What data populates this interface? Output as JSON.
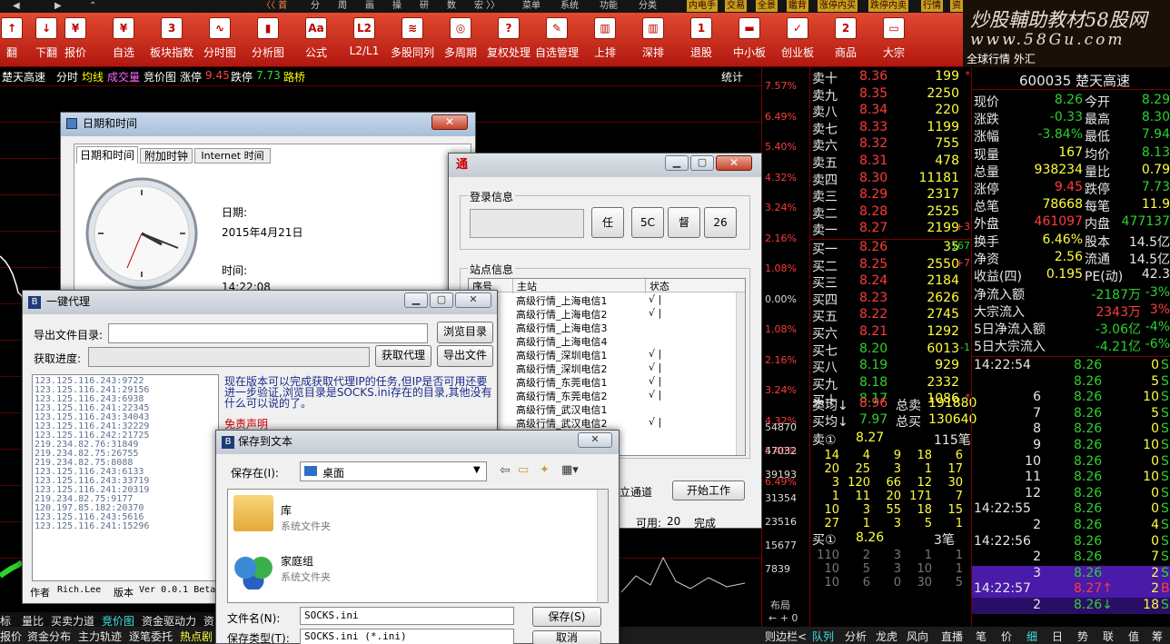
{
  "topstrip": {
    "items": [
      "〈〈 首",
      "分",
      "周",
      "画",
      "操",
      "研",
      "数",
      "宏 〉〉",
      "菜单",
      "系统",
      "功能",
      "分类"
    ],
    "tags": [
      "内电手",
      "交易",
      "全景",
      "鑑背",
      "涨停内买",
      "跌停内卖",
      "行情",
      "资"
    ]
  },
  "toolbar": {
    "buttons": [
      {
        "label": "翻",
        "icon": "arrow-up-icon"
      },
      {
        "label": "下翻",
        "icon": "arrow-down-icon"
      },
      {
        "label": "报价",
        "icon": "yen-icon"
      },
      {
        "label": "自选",
        "icon": "star-yen-icon"
      },
      {
        "label": "板块指数",
        "icon": "calendar-3-icon"
      },
      {
        "label": "分时图",
        "icon": "line-chart-icon"
      },
      {
        "label": "分析图",
        "icon": "candle-icon"
      },
      {
        "label": "公式",
        "icon": "formula-icon"
      },
      {
        "label": "L2/L1",
        "icon": "l2-icon"
      },
      {
        "label": "多股同列",
        "icon": "multi-chart-icon"
      },
      {
        "label": "多周期",
        "icon": "period-icon"
      },
      {
        "label": "复权处理",
        "icon": "adjust-icon"
      },
      {
        "label": "自选管理",
        "icon": "manage-icon"
      },
      {
        "label": "上排",
        "icon": "bars-icon"
      },
      {
        "label": "深排",
        "icon": "bars2-icon"
      },
      {
        "label": "退股",
        "icon": "calendar-1-icon"
      },
      {
        "label": "中小板",
        "icon": "panel-icon"
      },
      {
        "label": "创业板",
        "icon": "board-icon"
      },
      {
        "label": "商品",
        "icon": "calendar-2-icon"
      },
      {
        "label": "大宗",
        "icon": "folder-icon"
      }
    ],
    "ic_text": [
      "↑",
      "↓",
      "¥",
      "¥",
      "3",
      "∿",
      "▮",
      "Aa",
      "L2",
      "≋",
      "◎",
      "?",
      "✎",
      "▥",
      "▥",
      "1",
      "▬",
      "✓",
      "2",
      "▭"
    ]
  },
  "logo": {
    "line1": "炒股輔助教材58股网",
    "line2": "www.58Gu.com",
    "line3": "全球行情    外汇"
  },
  "chart": {
    "header": {
      "stock": "楚天高速",
      "t1": "分时",
      "t2": "均线",
      "t3": "成交量",
      "t4": "竞价图",
      "t5": "涨停",
      "zt": "9.45",
      "t6": "跌停",
      "dt": "7.73",
      "t7": "路桥",
      "tj": "统计"
    },
    "pcts": [
      "7.57%",
      "6.49%",
      "5.40%",
      "4.32%",
      "3.24%",
      "2.16%",
      "1.08%",
      "0.00%",
      "1.08%",
      "2.16%",
      "3.24%",
      "4.32%",
      "5.40%",
      "6.49%"
    ],
    "vols": [
      "54870",
      "47032",
      "39193",
      "31354",
      "23516",
      "15677",
      "7839"
    ],
    "bottom_labels": {
      "b": "布局",
      "nav": "← + 0"
    }
  },
  "book": {
    "sell": [
      {
        "l": "卖十",
        "p": "8.36",
        "v": "199",
        "f": "*"
      },
      {
        "l": "卖九",
        "p": "8.35",
        "v": "2250",
        "f": ""
      },
      {
        "l": "卖八",
        "p": "8.34",
        "v": "220",
        "f": ""
      },
      {
        "l": "卖七",
        "p": "8.33",
        "v": "1199",
        "f": ""
      },
      {
        "l": "卖六",
        "p": "8.32",
        "v": "755",
        "f": ""
      },
      {
        "l": "卖五",
        "p": "8.31",
        "v": "478",
        "f": ""
      },
      {
        "l": "卖四",
        "p": "8.30",
        "v": "11181",
        "f": ""
      },
      {
        "l": "卖三",
        "p": "8.29",
        "v": "2317",
        "f": ""
      },
      {
        "l": "卖二",
        "p": "8.28",
        "v": "2525",
        "f": ""
      },
      {
        "l": "卖一",
        "p": "8.27",
        "v": "2199",
        "f": "+3"
      }
    ],
    "buy": [
      {
        "l": "买一",
        "p": "8.26",
        "v": "35",
        "f": "-167"
      },
      {
        "l": "买二",
        "p": "8.25",
        "v": "2550",
        "f": "+7"
      },
      {
        "l": "买三",
        "p": "8.24",
        "v": "2184",
        "f": ""
      },
      {
        "l": "买四",
        "p": "8.23",
        "v": "2626",
        "f": ""
      },
      {
        "l": "买五",
        "p": "8.22",
        "v": "2745",
        "f": ""
      },
      {
        "l": "买六",
        "p": "8.21",
        "v": "1292",
        "f": ""
      },
      {
        "l": "买七",
        "p": "8.20",
        "v": "6013",
        "f": "-1"
      },
      {
        "l": "买八",
        "p": "8.19",
        "v": "929",
        "f": ""
      },
      {
        "l": "买九",
        "p": "8.18",
        "v": "2332",
        "f": ""
      },
      {
        "l": "买十",
        "p": "8.17",
        "v": "1086",
        "f": "*"
      }
    ],
    "avg_sell": {
      "l": "卖均↓",
      "p": "8.96",
      "l2": "总卖",
      "v": "191880"
    },
    "avg_buy": {
      "l": "买均↓",
      "p": "7.97",
      "l2": "总买",
      "v": "130640"
    },
    "sell1": {
      "l": "卖①",
      "p": "8.27",
      "v": "115笔"
    },
    "sell_grid": [
      [
        "14",
        "4",
        "9",
        "18",
        "6"
      ],
      [
        "20",
        "25",
        "3",
        "1",
        "17"
      ],
      [
        "3",
        "120",
        "66",
        "12",
        "30"
      ],
      [
        "1",
        "11",
        "20",
        "171",
        "7"
      ],
      [
        "10",
        "3",
        "55",
        "18",
        "15"
      ],
      [
        "27",
        "1",
        "3",
        "5",
        "1"
      ]
    ],
    "buy1": {
      "l": "买①",
      "p": "8.26",
      "v": "3笔"
    },
    "buy_grid": [
      [
        "110",
        "2",
        "3",
        "1",
        "1"
      ],
      [
        "10",
        "5",
        "3",
        "10",
        "1"
      ],
      [
        "10",
        "6",
        "0",
        "30",
        "5"
      ]
    ]
  },
  "info": {
    "title": "600035 楚天高速",
    "rows": [
      {
        "a": "现价",
        "b": "8.26",
        "c": "今开",
        "d": "8.29"
      },
      {
        "a": "涨跌",
        "b": "-0.33",
        "c": "最高",
        "d": "8.30"
      },
      {
        "a": "涨幅",
        "b": "-3.84%",
        "c": "最低",
        "d": "7.94"
      },
      {
        "a": "现量",
        "b": "167",
        "c": "均价",
        "d": "8.13"
      },
      {
        "a": "总量",
        "b": "938234",
        "c": "量比",
        "d": "0.79"
      },
      {
        "a": "涨停",
        "b": "9.45",
        "c": "跌停",
        "d": "7.73"
      },
      {
        "a": "总笔",
        "b": "78668",
        "c": "每笔",
        "d": "11.9"
      },
      {
        "a": "外盘",
        "b": "461097",
        "c": "内盘",
        "d": "477137"
      },
      {
        "a": "换手",
        "b": "6.46%",
        "c": "股本",
        "d": "14.5亿"
      },
      {
        "a": "净资",
        "b": "2.56",
        "c": "流通",
        "d": "14.5亿"
      },
      {
        "a": "收益(四)",
        "b": "0.195",
        "c": "PE(动)",
        "d": "42.3"
      }
    ],
    "flows": [
      {
        "a": "净流入额",
        "b": "-2187万",
        "c": "-3%"
      },
      {
        "a": "大宗流入",
        "b": "2343万",
        "c": "3%"
      },
      {
        "a": "5日净流入额",
        "b": "-3.06亿",
        "c": "-4%"
      },
      {
        "a": "5日大宗流入",
        "b": "-4.21亿",
        "c": "-6%"
      }
    ],
    "ticks": [
      {
        "t": "14:22:54",
        "p": "8.26",
        "v": "0",
        "d": "S"
      },
      {
        "t": "",
        "p": "8.26",
        "v": "5",
        "d": "S"
      },
      {
        "t": "6",
        "p": "8.26",
        "v": "10",
        "d": "S"
      },
      {
        "t": "7",
        "p": "8.26",
        "v": "5",
        "d": "S"
      },
      {
        "t": "8",
        "p": "8.26",
        "v": "0",
        "d": "S"
      },
      {
        "t": "9",
        "p": "8.26",
        "v": "10",
        "d": "S"
      },
      {
        "t": "10",
        "p": "8.26",
        "v": "0",
        "d": "S"
      },
      {
        "t": "11",
        "p": "8.26",
        "v": "10",
        "d": "S"
      },
      {
        "t": "12",
        "p": "8.26",
        "v": "0",
        "d": "S"
      },
      {
        "t": "14:22:55",
        "p": "8.26",
        "v": "0",
        "d": "S"
      },
      {
        "t": "2",
        "p": "8.26",
        "v": "4",
        "d": "S"
      },
      {
        "t": "14:22:56",
        "p": "8.26",
        "v": "0",
        "d": "S"
      },
      {
        "t": "2",
        "p": "8.26",
        "v": "7",
        "d": "S"
      },
      {
        "t": "3",
        "p": "8.26",
        "v": "2",
        "d": "S"
      },
      {
        "t": "14:22:57",
        "p": "8.27↑",
        "v": "2",
        "d": "B"
      },
      {
        "t": "2",
        "p": "8.26↓",
        "v": "18",
        "d": "S"
      }
    ]
  },
  "bottombar": {
    "row1": [
      "标",
      "量比",
      "买卖力道",
      "竞价图",
      "资金驱动力",
      "资"
    ],
    "row2": [
      "报价",
      "资金分布",
      "主力轨迹",
      "逐笔委托",
      "热点剧"
    ],
    "right": [
      "则边栏<",
      "队列",
      "分析",
      "龙虎",
      "风向",
      "直播",
      "笔",
      "价",
      "细",
      "日",
      "势",
      "联",
      "值",
      "筹"
    ]
  },
  "datetime_win": {
    "title": "日期和时间",
    "tabs": [
      "日期和时间",
      "附加时钟",
      "Internet 时间"
    ],
    "date_label": "日期:",
    "date": "2015年4月21日",
    "time_label": "时间:",
    "time": "14:22:08"
  },
  "login_win": {
    "group1": "登录信息",
    "btns": [
      "任",
      "5C",
      "督",
      "26"
    ],
    "group2": "站点信息",
    "cols": [
      "序号",
      "主站",
      "状态"
    ],
    "sites": [
      {
        "n": "高级行情_上海电信1",
        "s": "√ |"
      },
      {
        "n": "高级行情_上海电信2",
        "s": "√ |"
      },
      {
        "n": "高级行情_上海电信3",
        "s": ""
      },
      {
        "n": "高级行情_上海电信4",
        "s": ""
      },
      {
        "n": "高级行情_深圳电信1",
        "s": "√ |"
      },
      {
        "n": "高级行情_深圳电信2",
        "s": "√ |"
      },
      {
        "n": "高级行情_东莞电信1",
        "s": "√ |"
      },
      {
        "n": "高级行情_东莞电信2",
        "s": "√ |"
      },
      {
        "n": "高级行情_武汉电信1",
        "s": ""
      },
      {
        "n": "高级行情_武汉电信2",
        "s": "√ |"
      }
    ],
    "channel": "立通道",
    "start": "开始工作",
    "avail_label": "可用:",
    "avail": "20",
    "status": "完成"
  },
  "proxy_win": {
    "title": "一键代理",
    "export_label": "导出文件目录:",
    "browse": "浏览目录",
    "progress_label": "获取进度:",
    "fetch": "获取代理",
    "export": "导出文件",
    "proxies": [
      "123.125.116.243:9722",
      "123.125.116.241:29156",
      "123.125.116.243:6938",
      "123.125.116.241:22345",
      "123.125.116.243:34043",
      "123.125.116.241:32229",
      "123.125.116.242:21725",
      "219.234.82.76:31849",
      "219.234.82.75:26755",
      "219.234.82.75:8088",
      "123.125.116.243:6133",
      "123.125.116.243:33719",
      "123.125.116.241:20319",
      "219.234.82.75:9177",
      "120.197.85.182:20370",
      "123.125.116.243:5616",
      "123.125.116.241:15296"
    ],
    "desc": "现在版本可以完成获取代理IP的任务,但IP是否可用还要进一步验证,浏览目录是SOCKS.ini存在的目录,其他没有什么可以说的了。",
    "disclaimer": "免责声明",
    "author_label": "作者",
    "author": "Rich.Lee",
    "ver_label": "版本",
    "ver": "Ver 0.0.1 Beta"
  },
  "save_win": {
    "title": "保存到文本",
    "savein_label": "保存在(I):",
    "savein": "桌面",
    "items": [
      {
        "name": "库",
        "type": "系统文件夹",
        "icon": "library-folder-icon"
      },
      {
        "name": "家庭组",
        "type": "系统文件夹",
        "icon": "homegroup-icon"
      }
    ],
    "filename_label": "文件名(N):",
    "filename": "SOCKS.ini",
    "filetype_label": "保存类型(T):",
    "filetype": "SOCKS.ini (*.ini)",
    "save": "保存(S)",
    "cancel": "取消"
  }
}
